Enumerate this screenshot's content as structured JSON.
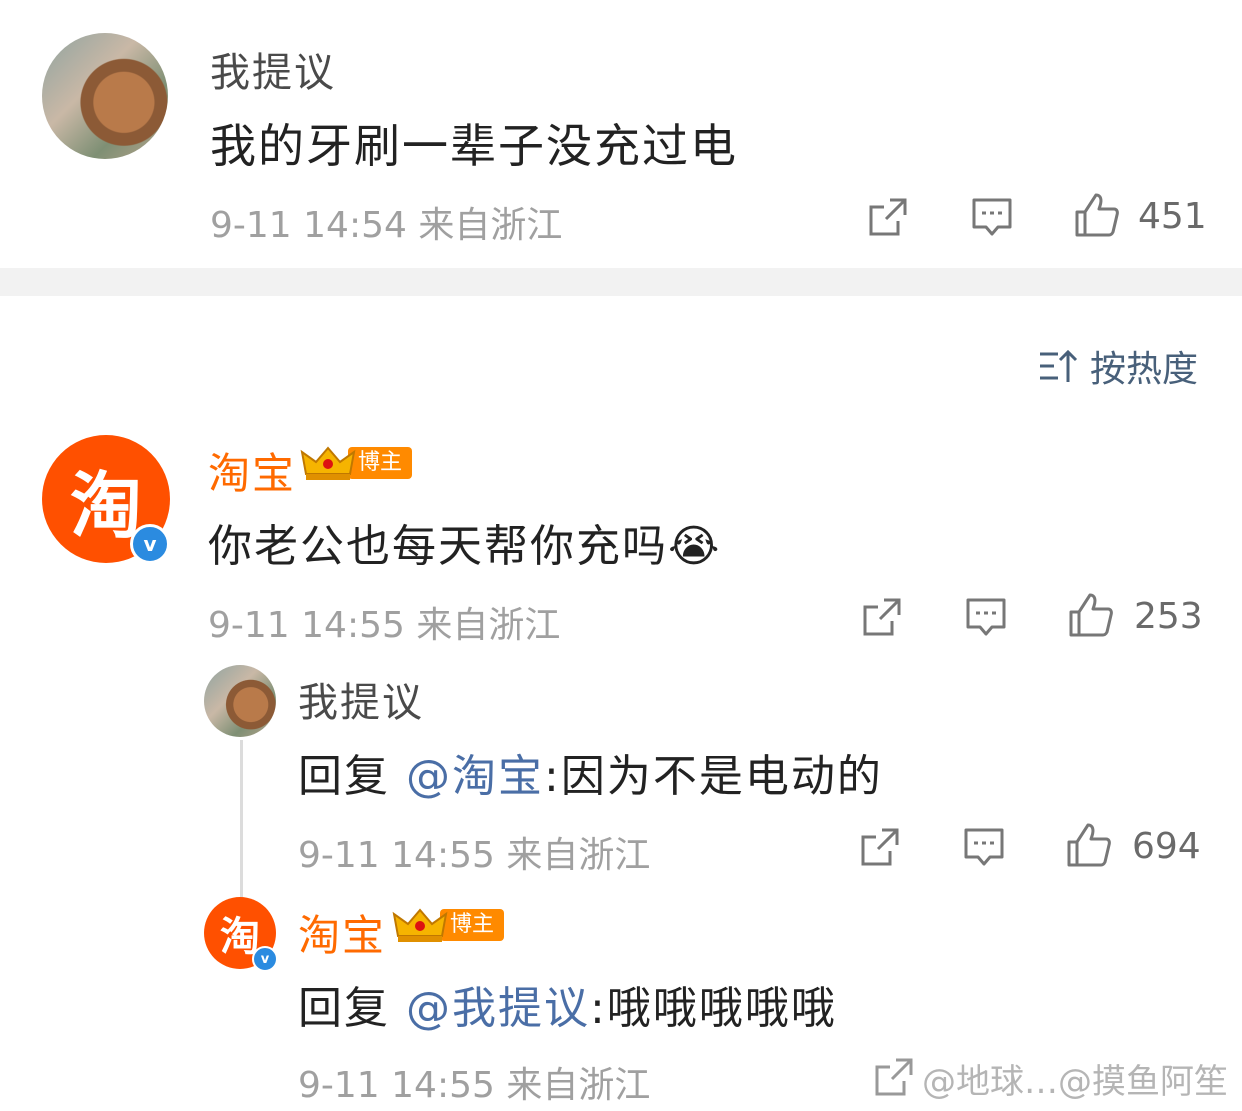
{
  "post": {
    "username": "我提议",
    "content": "我的牙刷一辈子没充过电",
    "meta": "9-11 14:54  来自浙江",
    "likes": "451"
  },
  "sort": {
    "label": "按热度"
  },
  "comment1": {
    "username": "淘宝",
    "badge": "博主",
    "avatar_char": "淘",
    "content": "你老公也每天帮你充吗",
    "emoji": "😭",
    "meta": "9-11 14:55  来自浙江",
    "likes": "253"
  },
  "reply1": {
    "username": "我提议",
    "prefix": "回复 ",
    "mention": "@淘宝",
    "text": ":因为不是电动的",
    "meta": "9-11 14:55  来自浙江",
    "likes": "694"
  },
  "reply2": {
    "username": "淘宝",
    "badge": "博主",
    "avatar_char": "淘",
    "prefix": "回复 ",
    "mention": "@我提议",
    "text": ":哦哦哦哦哦",
    "meta": "9-11 14:55  来自浙江"
  },
  "watermark": "@地球…@摸鱼阿笙",
  "colors": {
    "taobao_orange": "#ff5000",
    "mention_blue": "#4a6ea6",
    "meta_gray": "#a0a0a0"
  },
  "icons": [
    "share-icon",
    "comment-icon",
    "like-icon",
    "sort-icon",
    "verified-icon",
    "crown-icon"
  ]
}
